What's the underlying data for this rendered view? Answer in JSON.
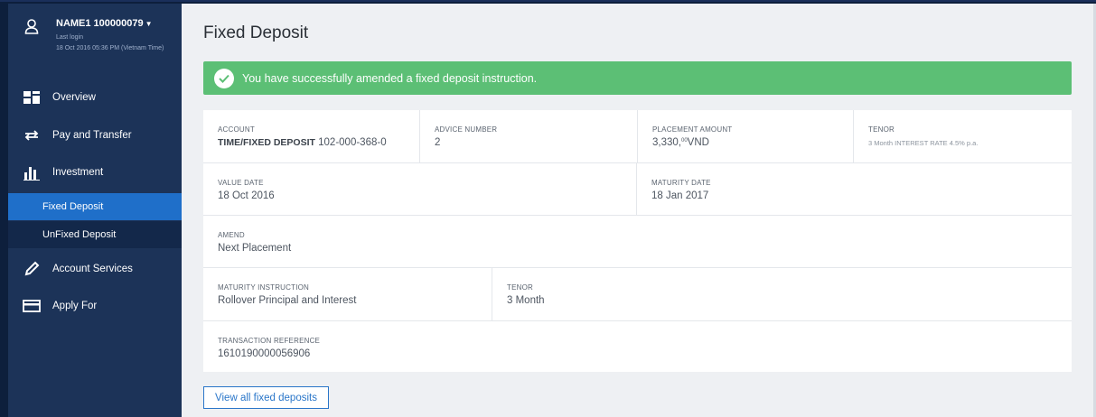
{
  "user": {
    "name": "NAME1 100000079",
    "last_login_label": "Last login",
    "last_login_time": "18 Oct 2016 05:36 PM (Vietnam Time)"
  },
  "nav": {
    "overview": "Overview",
    "pay_transfer": "Pay and Transfer",
    "investment": "Investment",
    "fixed_deposit": "Fixed Deposit",
    "unfixed_deposit": "UnFixed Deposit",
    "account_services": "Account Services",
    "apply_for": "Apply For"
  },
  "page": {
    "title": "Fixed Deposit",
    "alert": "You have successfully amended a fixed deposit instruction."
  },
  "details": {
    "account_label": "ACCOUNT",
    "account_type": "TIME/FIXED DEPOSIT",
    "account_number": "102-000-368-0",
    "advice_label": "ADVICE NUMBER",
    "advice_value": "2",
    "placement_label": "PLACEMENT AMOUNT",
    "placement_main": "3,330,",
    "placement_sup": "00",
    "placement_currency": "VND",
    "tenor_label": "TENOR",
    "tenor_value": "3 Month INTEREST RATE 4.5% p.a.",
    "value_date_label": "VALUE DATE",
    "value_date": "18 Oct 2016",
    "maturity_date_label": "MATURITY DATE",
    "maturity_date": "18 Jan 2017",
    "amend_label": "AMEND",
    "amend_value": "Next Placement",
    "maturity_instruction_label": "MATURITY INSTRUCTION",
    "maturity_instruction": "Rollover Principal and Interest",
    "tenor2_label": "TENOR",
    "tenor2_value": "3 Month",
    "txn_ref_label": "TRANSACTION REFERENCE",
    "txn_ref": "1610190000056906"
  },
  "actions": {
    "view_all": "View all fixed deposits"
  },
  "colors": {
    "sidebar": "#1c3358",
    "active": "#1f6fc9",
    "success": "#5cbf75",
    "link": "#2a76c9"
  },
  "icons": {
    "user": "user-icon",
    "overview": "dashboard-icon",
    "pay": "transfer-arrows-icon",
    "investment": "bar-chart-icon",
    "services": "pencil-icon",
    "apply": "card-icon",
    "alert": "check-circle-icon"
  }
}
